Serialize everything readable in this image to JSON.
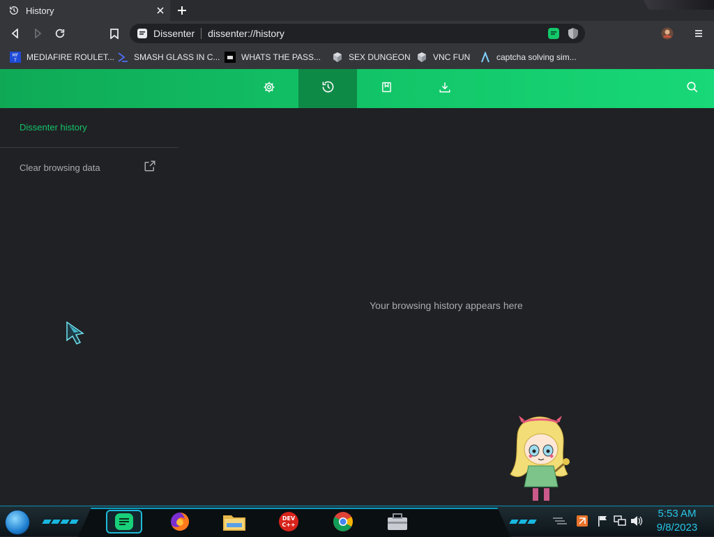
{
  "tab": {
    "title": "History",
    "close": "×"
  },
  "omnibox": {
    "site_label": "Dissenter",
    "url": "dissenter://history"
  },
  "bookmarks": [
    {
      "label": "MEDIAFIRE ROULET...",
      "icon": "mediafire-icon"
    },
    {
      "label": "SMASH GLASS IN C...",
      "icon": "glass-icon"
    },
    {
      "label": "WHATS THE PASS...",
      "icon": "terminal-icon"
    },
    {
      "label": "SEX DUNGEON",
      "icon": "cube-icon"
    },
    {
      "label": "VNC FUN",
      "icon": "cube-icon"
    },
    {
      "label": "captcha solving sim...",
      "icon": "lambda-icon"
    }
  ],
  "appbar": {
    "buttons": [
      "settings-icon",
      "history-icon",
      "bookmark-icon",
      "download-icon"
    ],
    "active": "history-icon"
  },
  "sidebar": {
    "title": "Dissenter history",
    "clear_label": "Clear browsing data"
  },
  "main": {
    "empty_message": "Your browsing history appears here"
  },
  "taskbar": {
    "apps": [
      "notes-app",
      "firefox",
      "file-explorer",
      "dev-cpp",
      "chrome",
      "toolbox"
    ],
    "time": "5:53 AM",
    "date": "9/8/2023"
  },
  "colors": {
    "accent_green": "#13c86a",
    "active_tab_green": "#0e8a47",
    "page_bg": "#202124",
    "clock_cyan": "#29c6e8"
  }
}
